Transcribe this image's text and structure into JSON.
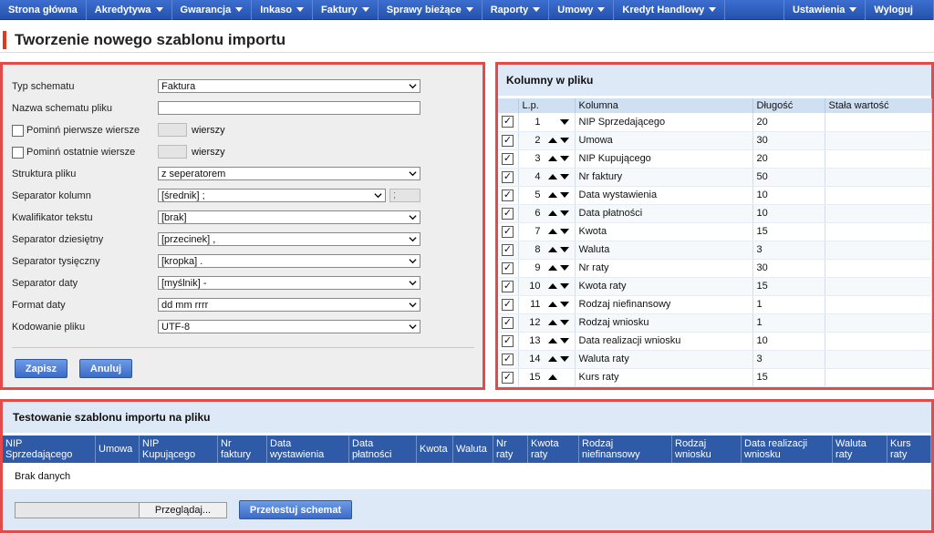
{
  "nav": {
    "items": [
      "Strona główna",
      "Akredytywa",
      "Gwarancja",
      "Inkaso",
      "Faktury",
      "Sprawy bieżące",
      "Raporty",
      "Umowy",
      "Kredyt Handlowy"
    ],
    "settings": "Ustawienia",
    "logout": "Wyloguj"
  },
  "page": {
    "title": "Tworzenie nowego szablonu importu"
  },
  "form": {
    "typ_label": "Typ schematu",
    "typ_value": "Faktura",
    "nazwa_label": "Nazwa schematu pliku",
    "nazwa_value": "",
    "pomin_first_label": "Pominń pierwsze wiersze",
    "pomin_first_unit": "wierszy",
    "pomin_last_label": "Pominń ostatnie wiersze",
    "pomin_last_unit": "wierszy",
    "struktura_label": "Struktura pliku",
    "struktura_value": "z seperatorem",
    "sep_kol_label": "Separator kolumn",
    "sep_kol_value": "[średnik] ;",
    "sep_kol_extra": ";",
    "kwal_label": "Kwalifikator tekstu",
    "kwal_value": "[brak]",
    "sep_dzies_label": "Separator dziesiętny",
    "sep_dzies_value": "[przecinek] ,",
    "sep_tys_label": "Separator tysięczny",
    "sep_tys_value": "[kropka] .",
    "sep_daty_label": "Separator daty",
    "sep_daty_value": "[myślnik] -",
    "format_label": "Format daty",
    "format_value": "dd mm rrrr",
    "kod_label": "Kodowanie pliku",
    "kod_value": "UTF-8",
    "save": "Zapisz",
    "cancel": "Anuluj"
  },
  "columns": {
    "title": "Kolumny w pliku",
    "headers": [
      "L.p.",
      "Kolumna",
      "Długość",
      "Stała wartość"
    ],
    "rows": [
      {
        "lp": "1",
        "name": "NIP Sprzedającego",
        "len": "20",
        "up": false,
        "down": true
      },
      {
        "lp": "2",
        "name": "Umowa",
        "len": "30",
        "up": true,
        "down": true
      },
      {
        "lp": "3",
        "name": "NIP Kupującego",
        "len": "20",
        "up": true,
        "down": true
      },
      {
        "lp": "4",
        "name": "Nr faktury",
        "len": "50",
        "up": true,
        "down": true
      },
      {
        "lp": "5",
        "name": "Data wystawienia",
        "len": "10",
        "up": true,
        "down": true
      },
      {
        "lp": "6",
        "name": "Data płatności",
        "len": "10",
        "up": true,
        "down": true
      },
      {
        "lp": "7",
        "name": "Kwota",
        "len": "15",
        "up": true,
        "down": true
      },
      {
        "lp": "8",
        "name": "Waluta",
        "len": "3",
        "up": true,
        "down": true
      },
      {
        "lp": "9",
        "name": "Nr raty",
        "len": "30",
        "up": true,
        "down": true
      },
      {
        "lp": "10",
        "name": "Kwota raty",
        "len": "15",
        "up": true,
        "down": true
      },
      {
        "lp": "11",
        "name": "Rodzaj niefinansowy",
        "len": "1",
        "up": true,
        "down": true
      },
      {
        "lp": "12",
        "name": "Rodzaj wniosku",
        "len": "1",
        "up": true,
        "down": true
      },
      {
        "lp": "13",
        "name": "Data realizacji wniosku",
        "len": "10",
        "up": true,
        "down": true
      },
      {
        "lp": "14",
        "name": "Waluta raty",
        "len": "3",
        "up": true,
        "down": true
      },
      {
        "lp": "15",
        "name": "Kurs raty",
        "len": "15",
        "up": true,
        "down": false
      }
    ],
    "check_glyph": "✓"
  },
  "test": {
    "title": "Testowanie szablonu importu na pliku",
    "cols": [
      {
        "l1": "NIP",
        "l2": "Sprzedającego"
      },
      {
        "l1": "Umowa",
        "l2": ""
      },
      {
        "l1": "NIP",
        "l2": "Kupującego"
      },
      {
        "l1": "Nr",
        "l2": "faktury"
      },
      {
        "l1": "Data",
        "l2": "wystawienia"
      },
      {
        "l1": "Data",
        "l2": "płatności"
      },
      {
        "l1": "Kwota",
        "l2": ""
      },
      {
        "l1": "Waluta",
        "l2": ""
      },
      {
        "l1": "Nr",
        "l2": "raty"
      },
      {
        "l1": "Kwota",
        "l2": "raty"
      },
      {
        "l1": "Rodzaj",
        "l2": "niefinansowy"
      },
      {
        "l1": "Rodzaj",
        "l2": "wniosku"
      },
      {
        "l1": "Data realizacji",
        "l2": "wniosku"
      },
      {
        "l1": "Waluta",
        "l2": "raty"
      },
      {
        "l1": "Kurs",
        "l2": "raty"
      }
    ],
    "empty": "Brak danych",
    "browse": "Przeglądaj...",
    "run": "Przetestuj schemat"
  }
}
